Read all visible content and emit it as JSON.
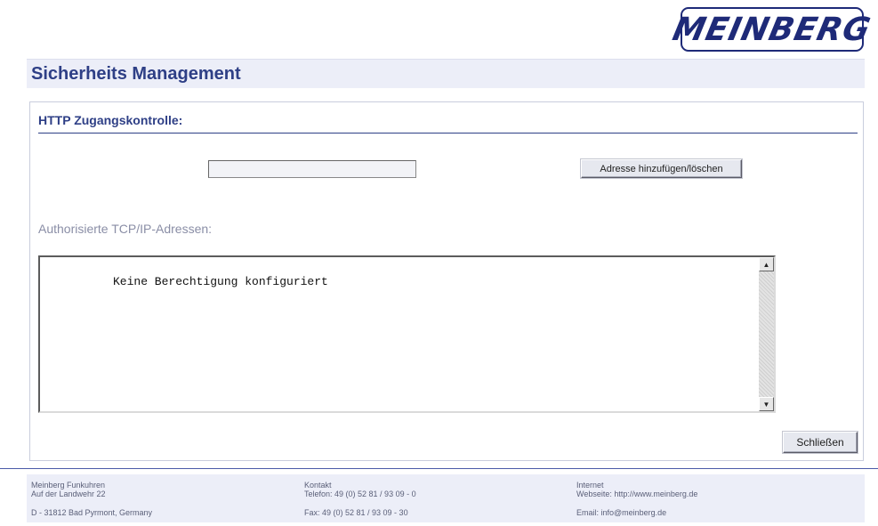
{
  "header": {
    "logo_text": "MEINBERG",
    "title": "Sicherheits Management"
  },
  "access_control": {
    "section_title": "HTTP Zugangskontrolle:",
    "address_input": {
      "value": "",
      "placeholder": ""
    },
    "add_button_label": "Adresse hinzufügen/löschen",
    "list_label": "Authorisierte TCP/IP-Adressen:",
    "list_empty_text": "Keine Berechtigung konfiguriert",
    "close_button_label": "Schließen"
  },
  "footer": {
    "company": {
      "name": "Meinberg Funkuhren",
      "street": "Auf der Landwehr 22",
      "city": "D - 31812 Bad Pyrmont, Germany"
    },
    "contact": {
      "heading": "Kontakt",
      "phone": "Telefon: 49 (0) 52 81 / 93 09 - 0",
      "fax": "Fax: 49 (0) 52 81 / 93 09 - 30"
    },
    "internet": {
      "heading": "Internet",
      "website": "Webseite: http://www.meinberg.de",
      "email": "Email: info@meinberg.de"
    }
  },
  "colors": {
    "brand": "#1e2a78",
    "title": "#2e3f86",
    "header_bg": "#eceef8"
  },
  "icons": {
    "scroll_up": "arrow-up-icon",
    "scroll_down": "arrow-down-icon"
  }
}
